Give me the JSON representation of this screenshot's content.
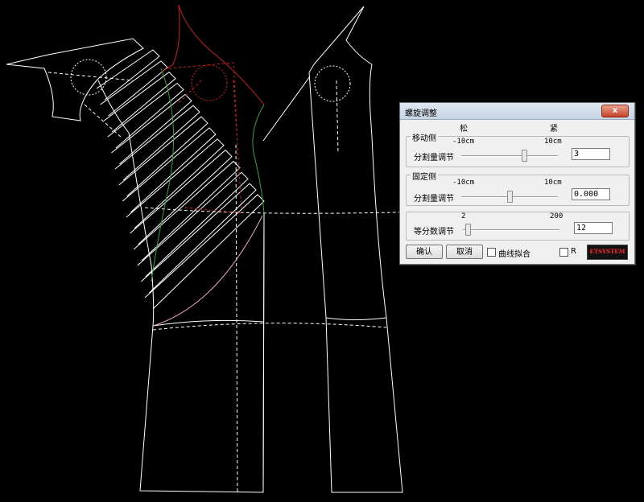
{
  "dialog": {
    "title": "螺旋调整",
    "close_label": "x",
    "header_loose": "松",
    "header_tight": "紧",
    "moving_side": {
      "group_label": "移动侧",
      "range_min": "-10cm",
      "range_max": "10cm",
      "row_label": "分割量调节",
      "value": "3",
      "slider_fraction": 0.65
    },
    "fixed_side": {
      "group_label": "固定侧",
      "range_min": "-10cm",
      "range_max": "10cm",
      "row_label": "分割量调节",
      "value": "0.000",
      "slider_fraction": 0.5
    },
    "divisions": {
      "range_min": "2",
      "range_max": "200",
      "row_label": "等分数调节",
      "value": "12",
      "slider_fraction": 0.05
    },
    "buttons": {
      "confirm": "确认",
      "cancel": "取消"
    },
    "curve_fit_label": "曲线拟合",
    "curve_fit_checked": false,
    "r_label": "R",
    "r_checked": false,
    "logo_text": "ETSYSTEM"
  },
  "colors": {
    "background": "#000000",
    "pattern_line": "#ffffff",
    "highlight_red": "#cc1b1b",
    "highlight_green": "#2fa63a",
    "highlight_pink": "#f0a8b0"
  }
}
